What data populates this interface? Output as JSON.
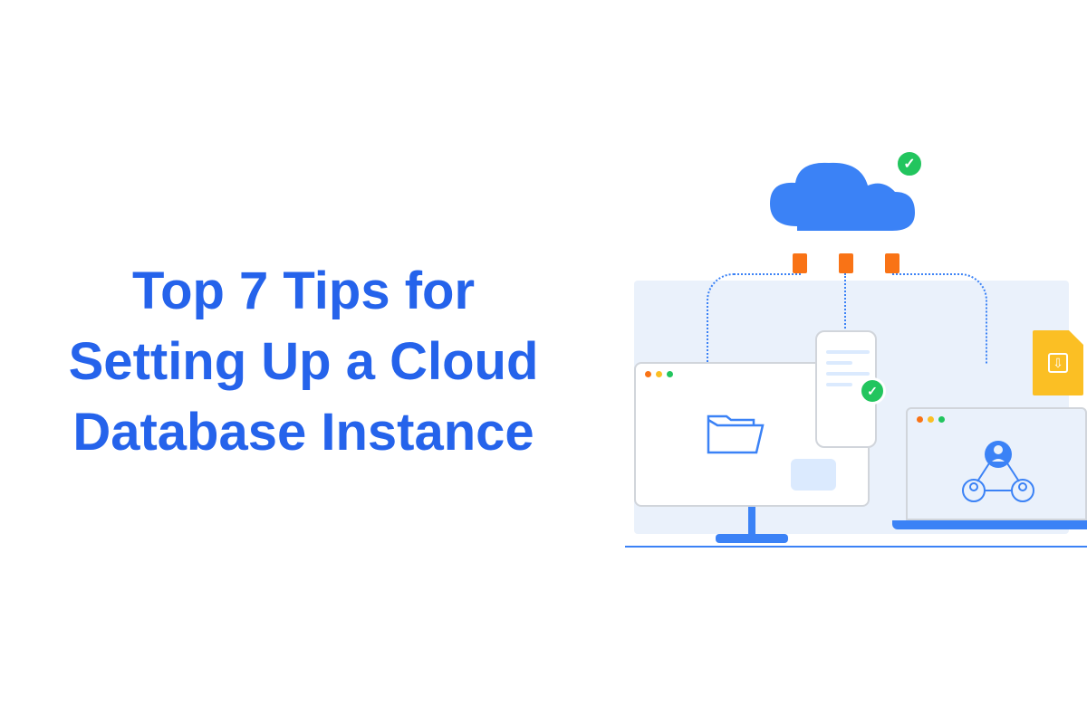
{
  "heading": "Top 7 Tips for Setting Up a Cloud Database Instance",
  "colors": {
    "primary": "#3b82f6",
    "accent": "#f97316",
    "success": "#22c55e",
    "warning": "#fbbf24",
    "bg_light": "#eaf1fb"
  },
  "illustration": {
    "cloud_status": "checked",
    "connections": 3,
    "devices": [
      "desktop-monitor",
      "smartphone",
      "laptop"
    ],
    "file_download": true
  }
}
